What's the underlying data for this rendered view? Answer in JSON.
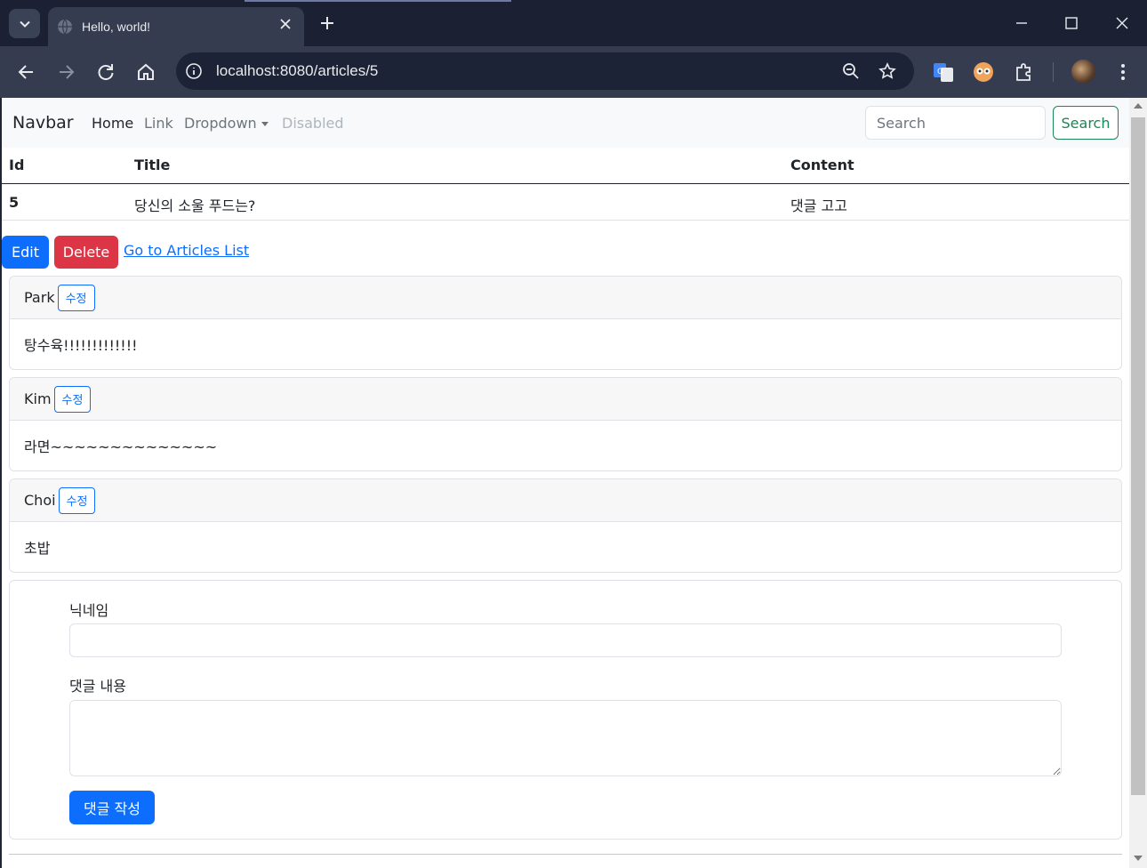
{
  "browser": {
    "tab_title": "Hello, world!",
    "url": "localhost:8080/articles/5"
  },
  "navbar": {
    "brand": "Navbar",
    "links": [
      "Home",
      "Link",
      "Dropdown",
      "Disabled"
    ],
    "search_placeholder": "Search",
    "search_button": "Search"
  },
  "table": {
    "headers": [
      "Id",
      "Title",
      "Content"
    ],
    "row": {
      "id": "5",
      "title": "당신의 소울 푸드는?",
      "content": "댓글 고고"
    }
  },
  "actions": {
    "edit": "Edit",
    "delete": "Delete",
    "list_link": "Go to Articles List"
  },
  "comments": [
    {
      "nickname": "Park",
      "edit_label": "수정",
      "body": "탕수육!!!!!!!!!!!!!"
    },
    {
      "nickname": "Kim",
      "edit_label": "수정",
      "body": "라면~~~~~~~~~~~~~~"
    },
    {
      "nickname": "Choi",
      "edit_label": "수정",
      "body": "초밥"
    }
  ],
  "comment_form": {
    "nickname_label": "닉네임",
    "content_label": "댓글 내용",
    "submit": "댓글 작성"
  }
}
